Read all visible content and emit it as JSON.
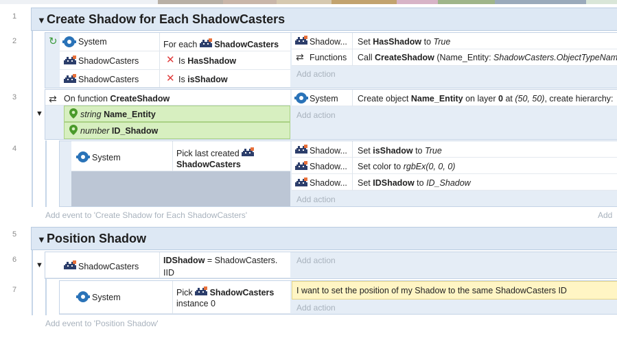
{
  "line_numbers": [
    "1",
    "2",
    "3",
    "4",
    "5",
    "6",
    "7"
  ],
  "groups": [
    {
      "title": "Create Shadow for Each ShadowCasters"
    },
    {
      "title": "Position Shadow"
    }
  ],
  "events": {
    "e2": {
      "conditions": [
        {
          "object": "System",
          "text_pre": "For each",
          "target": "ShadowCasters"
        },
        {
          "object": "ShadowCasters",
          "text_pre": "Is",
          "target": "HasShadow"
        },
        {
          "object": "ShadowCasters",
          "text_pre": "Is",
          "target": "isShadow"
        }
      ],
      "actions": [
        {
          "object": "Shadow...",
          "pre": "Set",
          "bold": "HasShadow",
          "mid": "to",
          "ital": "True"
        },
        {
          "object": "Functions",
          "pre": "Call",
          "bold": "CreateShadow",
          "mid": "(Name_Entity:",
          "ital": "ShadowCasters.ObjectTypeName"
        }
      ],
      "add_action": "Add action"
    },
    "e3": {
      "trigger_pre": "On function",
      "trigger_name": "CreateShadow",
      "params": [
        {
          "type": "string",
          "name": "Name_Entity"
        },
        {
          "type": "number",
          "name": "ID_Shadow"
        }
      ],
      "action": {
        "object": "System",
        "pre": "Create object",
        "bold1": "Name_Entity",
        "mid1": "on layer",
        "bold2": "0",
        "mid2": "at",
        "ital": "(50, 50)",
        "post": ", create hierarchy:"
      },
      "add_action": "Add action"
    },
    "e4": {
      "condition": {
        "object": "System",
        "line1": "Pick last created",
        "line2": "ShadowCasters"
      },
      "actions": [
        {
          "object": "Shadow...",
          "pre": "Set",
          "bold": "isShadow",
          "mid": "to",
          "ital": "True"
        },
        {
          "object": "Shadow...",
          "pre": "Set color to",
          "bold": "",
          "mid": "",
          "ital": "rgbEx(0, 0, 0)"
        },
        {
          "object": "Shadow...",
          "pre": "Set",
          "bold": "IDShadow",
          "mid": "to",
          "ital": "ID_Shadow"
        }
      ],
      "add_action": "Add action"
    },
    "add_event_1": "Add event to 'Create Shadow for Each ShadowCasters'",
    "add_right": "Add",
    "e6": {
      "condition": {
        "object": "ShadowCasters",
        "bold": "IDShadow",
        "rest": "= ShadowCasters.",
        "line2": "IID"
      },
      "add_action": "Add action"
    },
    "e7": {
      "condition": {
        "object": "System",
        "pre": "Pick",
        "target": "ShadowCasters",
        "line2": "instance 0"
      },
      "comment": "I want to set the position of my Shadow to the same ShadowCasters ID",
      "add_action": "Add action"
    },
    "add_event_2": "Add event to 'Position Shadow'"
  },
  "colors": {
    "group_bg": "#dde8f4",
    "event_bg": "#e5edf6",
    "param_bg": "#d7efc0",
    "comment_bg": "#fff5c4",
    "gear": "#2a73b8",
    "xmark": "#e03b3b"
  },
  "icons": [
    "gear-icon",
    "sprite-icon",
    "x-icon",
    "loop-icon",
    "repeat-icon",
    "pin-icon",
    "triangle-down-icon"
  ]
}
